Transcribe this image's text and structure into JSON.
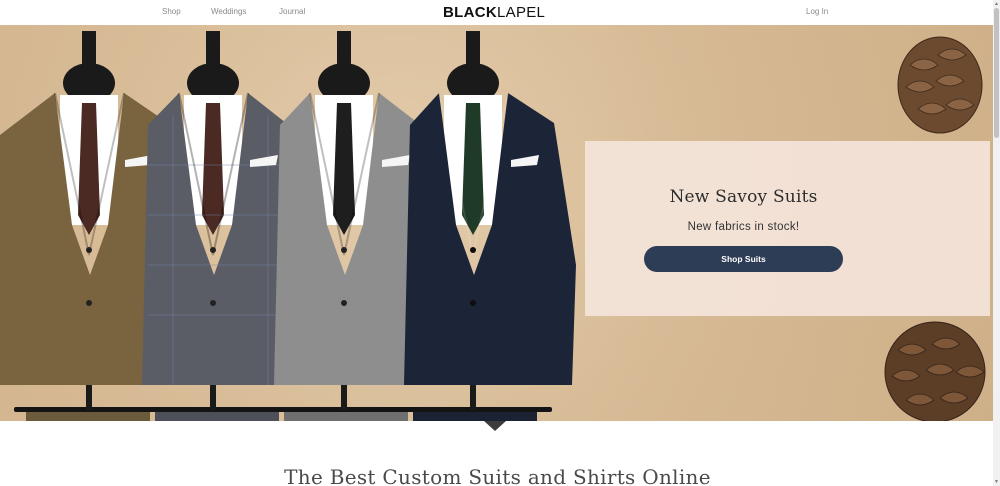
{
  "nav": {
    "shop": "Shop",
    "weddings": "Weddings",
    "journal": "Journal",
    "login": "Log In"
  },
  "logo": {
    "bold": "BLACK",
    "light": "LAPEL"
  },
  "hero": {
    "title": "New Savoy Suits",
    "subtitle": "New fabrics in stock!",
    "cta": "Shop Suits",
    "suit_colors": [
      "#7a6440",
      "#5a5d66",
      "#8e8e8e",
      "#1c2438"
    ],
    "tie_colors": [
      "#4a2a22",
      "#4b2a24",
      "#1e1e1e",
      "#1f3a26"
    ]
  },
  "section": {
    "title": "The Best Custom Suits and Shirts Online"
  },
  "colors": {
    "cta_bg": "#2e3d56",
    "promo_bg": "#f4e4da"
  }
}
